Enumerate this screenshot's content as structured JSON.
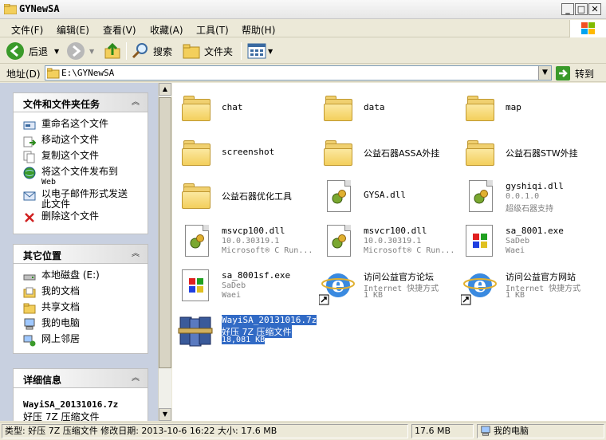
{
  "window": {
    "title": "GYNewSA"
  },
  "menu": [
    "文件(F)",
    "编辑(E)",
    "查看(V)",
    "收藏(A)",
    "工具(T)",
    "帮助(H)"
  ],
  "toolbar": {
    "back": "后退",
    "search": "搜索",
    "folders": "文件夹"
  },
  "address": {
    "label": "地址(D)",
    "value": "E:\\GYNewSA",
    "go": "转到"
  },
  "tasks_panel": {
    "title": "文件和文件夹任务",
    "items": [
      {
        "label": "重命名这个文件",
        "icon": "rename-icon"
      },
      {
        "label": "移动这个文件",
        "icon": "move-icon"
      },
      {
        "label": "复制这个文件",
        "icon": "copy-icon"
      },
      {
        "label": "将这个文件发布到",
        "label2": "Web",
        "icon": "publish-web-icon"
      },
      {
        "label": "以电子邮件形式发送",
        "label2": "此文件",
        "icon": "email-icon"
      },
      {
        "label": "删除这个文件",
        "icon": "delete-icon"
      }
    ]
  },
  "places_panel": {
    "title": "其它位置",
    "items": [
      {
        "label": "本地磁盘 (E:)",
        "icon": "local-disk-icon"
      },
      {
        "label": "我的文档",
        "icon": "my-documents-icon"
      },
      {
        "label": "共享文档",
        "icon": "shared-documents-icon"
      },
      {
        "label": "我的电脑",
        "icon": "my-computer-icon"
      },
      {
        "label": "网上邻居",
        "icon": "network-places-icon"
      }
    ]
  },
  "details_panel": {
    "title": "详细信息",
    "filename": "WayiSA_20131016.7z",
    "type": "好压 7Z 压缩文件"
  },
  "files": [
    {
      "name": "chat",
      "kind": "folder"
    },
    {
      "name": "data",
      "kind": "folder"
    },
    {
      "name": "map",
      "kind": "folder"
    },
    {
      "name": "screenshot",
      "kind": "folder"
    },
    {
      "name": "公益石器ASSA外挂",
      "kind": "folder"
    },
    {
      "name": "公益石器STW外挂",
      "kind": "folder"
    },
    {
      "name": "公益石器优化工具",
      "kind": "folder"
    },
    {
      "name": "GYSA.dll",
      "kind": "dll"
    },
    {
      "name": "gyshiqi.dll",
      "kind": "dll",
      "sub1": "0.0.1.0",
      "sub2": "超级石器支持"
    },
    {
      "name": "msvcp100.dll",
      "kind": "dll",
      "sub1": "10.0.30319.1",
      "sub2": "Microsoft® C Run..."
    },
    {
      "name": "msvcr100.dll",
      "kind": "dll",
      "sub1": "10.0.30319.1",
      "sub2": "Microsoft® C Run..."
    },
    {
      "name": "sa_8001.exe",
      "kind": "exe",
      "sub1": "SaDeb",
      "sub2": "Waei"
    },
    {
      "name": "sa_8001sf.exe",
      "kind": "exe",
      "sub1": "SaDeb",
      "sub2": "Waei"
    },
    {
      "name": "访问公益官方论坛",
      "kind": "shortcut",
      "sub1": "Internet 快捷方式",
      "sub2": "1 KB"
    },
    {
      "name": "访问公益官方网站",
      "kind": "shortcut",
      "sub1": "Internet 快捷方式",
      "sub2": "1 KB"
    },
    {
      "name": "WayiSA_20131016.7z",
      "kind": "archive",
      "sub1": "好压 7Z 压缩文件",
      "sub2": "18,081 KB",
      "selected": true
    }
  ],
  "status": {
    "info": "类型: 好压 7Z 压缩文件 修改日期: 2013-10-6 16:22 大小: 17.6 MB",
    "size": "17.6 MB",
    "location": "我的电脑"
  }
}
